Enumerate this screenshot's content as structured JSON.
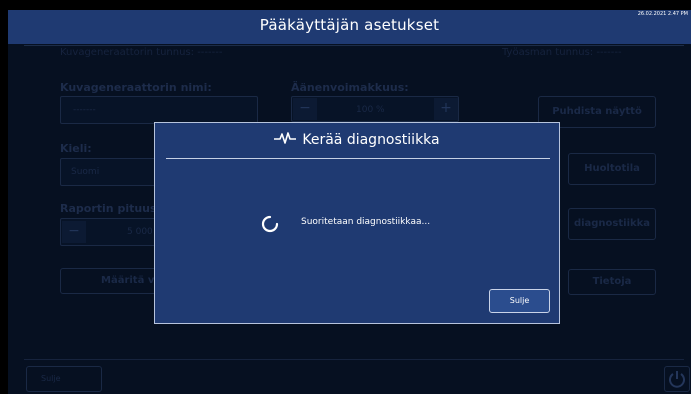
{
  "header": {
    "title": "Pääkäyttäjän asetukset",
    "datetime": "26.02.2021 2.47 PM"
  },
  "settings": {
    "generator_id_label": "Kuvageneraattorin tunnus: -------",
    "workstation_id_label": "Työasman tunnus: -------",
    "generator_name_label": "Kuvageneraattorin nimi:",
    "generator_name_value": "-------",
    "volume_label": "Äänenvoimakkuus:",
    "volume_value": "100 %",
    "language_label": "Kieli:",
    "language_value": "Suomi",
    "report_length_label": "Raportin pituusr",
    "report_length_value": "5 000",
    "define_button": "Määritä v",
    "clear_screen_button": "Puhdista näyttö",
    "service_mode_button": "Huoltotila",
    "diagnostics_button": "diagnostiikka",
    "info_button": "Tietoja",
    "minus": "−",
    "plus": "+"
  },
  "footer": {
    "close_label": "Sulje"
  },
  "modal": {
    "title": "Kerää diagnostiikka",
    "message": "Suoritetaan diagnostiikkaa...",
    "close_label": "Sulje"
  },
  "colors": {
    "header": "#1f3a72",
    "background": "#061021",
    "modal": "#1f3a72",
    "button": "#2b4d8e"
  },
  "icons": {
    "title_icon": "heartbeat-icon",
    "spinner": "loading-spinner-icon",
    "power": "power-icon"
  }
}
